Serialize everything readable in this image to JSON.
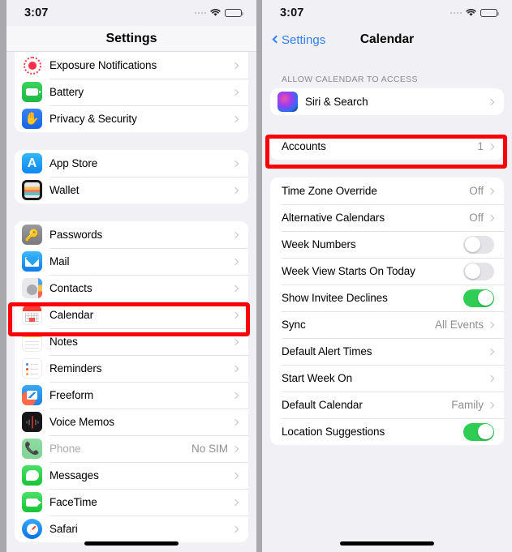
{
  "left_phone": {
    "status_bar": {
      "time": "3:07",
      "signal_icon": "signal-dots-icon",
      "wifi_icon": "wifi-icon",
      "battery_icon": "battery-icon"
    },
    "nav": {
      "title": "Settings"
    },
    "groups": [
      {
        "id": "group-system",
        "rows": [
          {
            "icon": "exposure-notifications-icon",
            "label": "Exposure Notifications",
            "value": "",
            "accessory": "chevron"
          },
          {
            "icon": "battery-app-icon",
            "label": "Battery",
            "value": "",
            "accessory": "chevron"
          },
          {
            "icon": "privacy-security-icon",
            "label": "Privacy & Security",
            "value": "",
            "accessory": "chevron"
          }
        ]
      },
      {
        "id": "group-store",
        "rows": [
          {
            "icon": "app-store-icon",
            "label": "App Store",
            "value": "",
            "accessory": "chevron"
          },
          {
            "icon": "wallet-icon",
            "label": "Wallet",
            "value": "",
            "accessory": "chevron"
          }
        ]
      },
      {
        "id": "group-apps",
        "rows": [
          {
            "icon": "passwords-icon",
            "label": "Passwords",
            "value": "",
            "accessory": "chevron"
          },
          {
            "icon": "mail-icon",
            "label": "Mail",
            "value": "",
            "accessory": "chevron"
          },
          {
            "icon": "contacts-icon",
            "label": "Contacts",
            "value": "",
            "accessory": "chevron"
          },
          {
            "icon": "calendar-icon",
            "label": "Calendar",
            "value": "",
            "accessory": "chevron",
            "highlighted": true
          },
          {
            "icon": "notes-icon",
            "label": "Notes",
            "value": "",
            "accessory": "chevron"
          },
          {
            "icon": "reminders-icon",
            "label": "Reminders",
            "value": "",
            "accessory": "chevron"
          },
          {
            "icon": "freeform-icon",
            "label": "Freeform",
            "value": "",
            "accessory": "chevron"
          },
          {
            "icon": "voice-memos-icon",
            "label": "Voice Memos",
            "value": "",
            "accessory": "chevron"
          },
          {
            "icon": "phone-icon",
            "label": "Phone",
            "value": "No SIM",
            "accessory": "chevron",
            "dimmed": true
          },
          {
            "icon": "messages-icon",
            "label": "Messages",
            "value": "",
            "accessory": "chevron"
          },
          {
            "icon": "facetime-icon",
            "label": "FaceTime",
            "value": "",
            "accessory": "chevron"
          },
          {
            "icon": "safari-icon",
            "label": "Safari",
            "value": "",
            "accessory": "chevron"
          }
        ]
      }
    ]
  },
  "right_phone": {
    "status_bar": {
      "time": "3:07",
      "signal_icon": "signal-dots-icon",
      "wifi_icon": "wifi-icon",
      "battery_icon": "battery-icon"
    },
    "nav": {
      "back_label": "Settings",
      "back_icon": "chevron-left-icon",
      "title": "Calendar"
    },
    "section_header": "ALLOW CALENDAR TO ACCESS",
    "groups": [
      {
        "id": "group-access",
        "rows": [
          {
            "icon": "siri-search-icon",
            "label": "Siri & Search",
            "value": "",
            "accessory": "chevron"
          }
        ]
      },
      {
        "id": "group-accounts",
        "rows": [
          {
            "label": "Accounts",
            "value": "1",
            "accessory": "chevron",
            "highlighted": true
          }
        ]
      },
      {
        "id": "group-calendar-settings",
        "rows": [
          {
            "label": "Time Zone Override",
            "value": "Off",
            "accessory": "chevron"
          },
          {
            "label": "Alternative Calendars",
            "value": "Off",
            "accessory": "chevron"
          },
          {
            "label": "Week Numbers",
            "value": "",
            "accessory": "toggle",
            "toggle_on": false
          },
          {
            "label": "Week View Starts On Today",
            "value": "",
            "accessory": "toggle",
            "toggle_on": false
          },
          {
            "label": "Show Invitee Declines",
            "value": "",
            "accessory": "toggle",
            "toggle_on": true
          },
          {
            "label": "Sync",
            "value": "All Events",
            "accessory": "chevron"
          },
          {
            "label": "Default Alert Times",
            "value": "",
            "accessory": "chevron"
          },
          {
            "label": "Start Week On",
            "value": "",
            "accessory": "chevron"
          },
          {
            "label": "Default Calendar",
            "value": "Family",
            "accessory": "chevron"
          },
          {
            "label": "Location Suggestions",
            "value": "",
            "accessory": "toggle",
            "toggle_on": true
          }
        ]
      }
    ]
  },
  "colors": {
    "highlight": "#fb0007",
    "accent_blue": "#2f7ff5",
    "toggle_on": "#2fcd53",
    "background": "#f1f1f5",
    "card": "#ffffff",
    "secondary_text": "#8e8e93"
  }
}
